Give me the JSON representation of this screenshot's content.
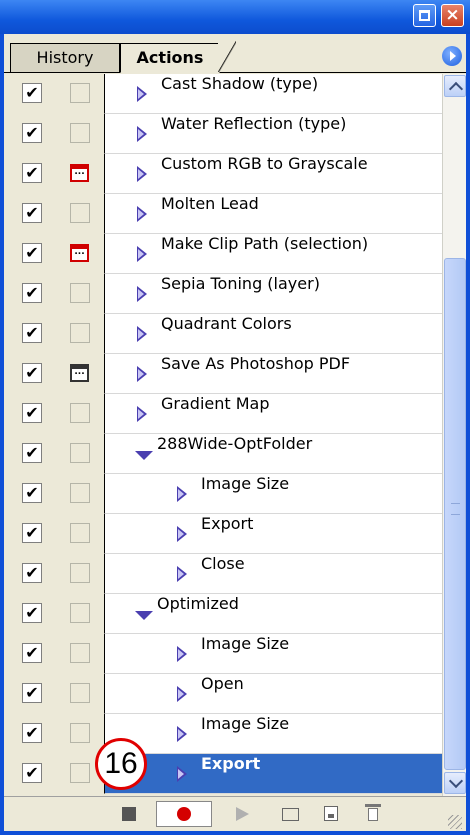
{
  "tabs": {
    "history": "History",
    "actions": "Actions"
  },
  "rows": [
    {
      "label": "Cast Shadow (type)",
      "check": "✔",
      "dialog": false,
      "kind": "action",
      "selected": false
    },
    {
      "label": "Water Reflection (type)",
      "check": "✔",
      "dialog": false,
      "kind": "action",
      "selected": false
    },
    {
      "label": "Custom RGB to Grayscale",
      "check": "✔",
      "dialog": "red",
      "kind": "action",
      "selected": false
    },
    {
      "label": "Molten Lead",
      "check": "✔",
      "dialog": false,
      "kind": "action",
      "selected": false
    },
    {
      "label": "Make Clip Path (selection)",
      "check": "✔",
      "dialog": "red",
      "kind": "action",
      "selected": false
    },
    {
      "label": "Sepia Toning (layer)",
      "check": "✔",
      "dialog": false,
      "kind": "action",
      "selected": false
    },
    {
      "label": "Quadrant Colors",
      "check": "✔",
      "dialog": false,
      "kind": "action",
      "selected": false
    },
    {
      "label": "Save As Photoshop PDF",
      "check": "✔",
      "dialog": "black",
      "kind": "action",
      "selected": false
    },
    {
      "label": "Gradient Map",
      "check": "✔",
      "dialog": false,
      "kind": "action",
      "selected": false
    },
    {
      "label": "288Wide-OptFolder",
      "check": "✔",
      "dialog": false,
      "kind": "open",
      "selected": false
    },
    {
      "label": "Image Size",
      "check": "✔",
      "dialog": false,
      "kind": "step",
      "selected": false
    },
    {
      "label": "Export",
      "check": "✔",
      "dialog": false,
      "kind": "step",
      "selected": false
    },
    {
      "label": "Close",
      "check": "✔",
      "dialog": false,
      "kind": "step",
      "selected": false
    },
    {
      "label": "Optimized",
      "check": "✔",
      "dialog": false,
      "kind": "open",
      "selected": false
    },
    {
      "label": "Image Size",
      "check": "✔",
      "dialog": false,
      "kind": "step",
      "selected": false
    },
    {
      "label": "Open",
      "check": "✔",
      "dialog": false,
      "kind": "step",
      "selected": false
    },
    {
      "label": "Image Size",
      "check": "✔",
      "dialog": false,
      "kind": "step",
      "selected": false
    },
    {
      "label": "Export",
      "check": "✔",
      "dialog": false,
      "kind": "step",
      "selected": true
    }
  ],
  "callout": "16",
  "colors": {
    "titlebar": "#0f58dc",
    "panel": "#ece9d8",
    "selection": "#316ac5",
    "dialog_red": "#d00000",
    "triangle": "#4a3fb0"
  },
  "icons": [
    "minimize-icon",
    "close-icon",
    "panel-menu-icon",
    "stop-icon",
    "record-icon",
    "play-icon",
    "folder-icon",
    "new-action-icon",
    "trash-icon"
  ],
  "glyphs": {
    "close": "×",
    "dialog": "..."
  }
}
